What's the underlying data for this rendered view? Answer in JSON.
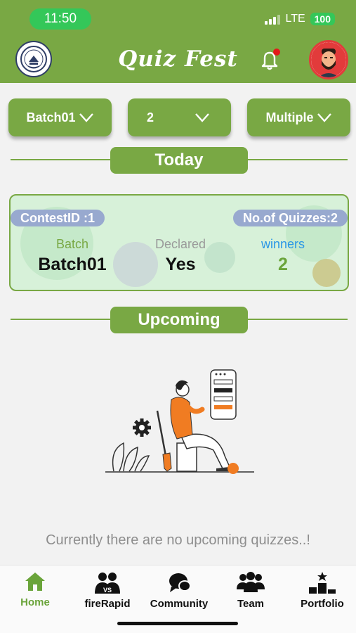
{
  "status": {
    "time": "11:50",
    "network": "LTE",
    "battery": "100"
  },
  "header": {
    "title": "Quiz Fest",
    "logo_icon": "institution-crest-icon",
    "bell_icon": "notification-bell-icon",
    "avatar_icon": "user-avatar-icon"
  },
  "filters": [
    {
      "value": "Batch01"
    },
    {
      "value": "2"
    },
    {
      "value": "Multiple"
    }
  ],
  "today": {
    "heading": "Today",
    "card": {
      "contest_id": "ContestID :1",
      "quiz_count": "No.of Quizzes:2",
      "batch_label": "Batch",
      "batch_value": "Batch01",
      "declared_label": "Declared",
      "declared_value": "Yes",
      "winners_label": "winners",
      "winners_value": "2"
    }
  },
  "upcoming": {
    "heading": "Upcoming",
    "empty_message": "Currently there are no upcoming quizzes..!",
    "illustration": "person-with-checklist-illustration"
  },
  "tabs": [
    {
      "label": "Home",
      "icon": "home-icon",
      "active": true
    },
    {
      "label": "fireRapid",
      "icon": "versus-icon",
      "active": false
    },
    {
      "label": "Community",
      "icon": "chat-bubbles-icon",
      "active": false
    },
    {
      "label": "Team",
      "icon": "team-icon",
      "active": false
    },
    {
      "label": "Portfolio",
      "icon": "podium-icon",
      "active": false
    }
  ],
  "colors": {
    "brand_green": "#79a844",
    "card_bg": "#d7f1d9",
    "tag_bg": "#98a9cf",
    "winners_blue": "#2a97e6",
    "accent_orange": "#f07c22"
  }
}
